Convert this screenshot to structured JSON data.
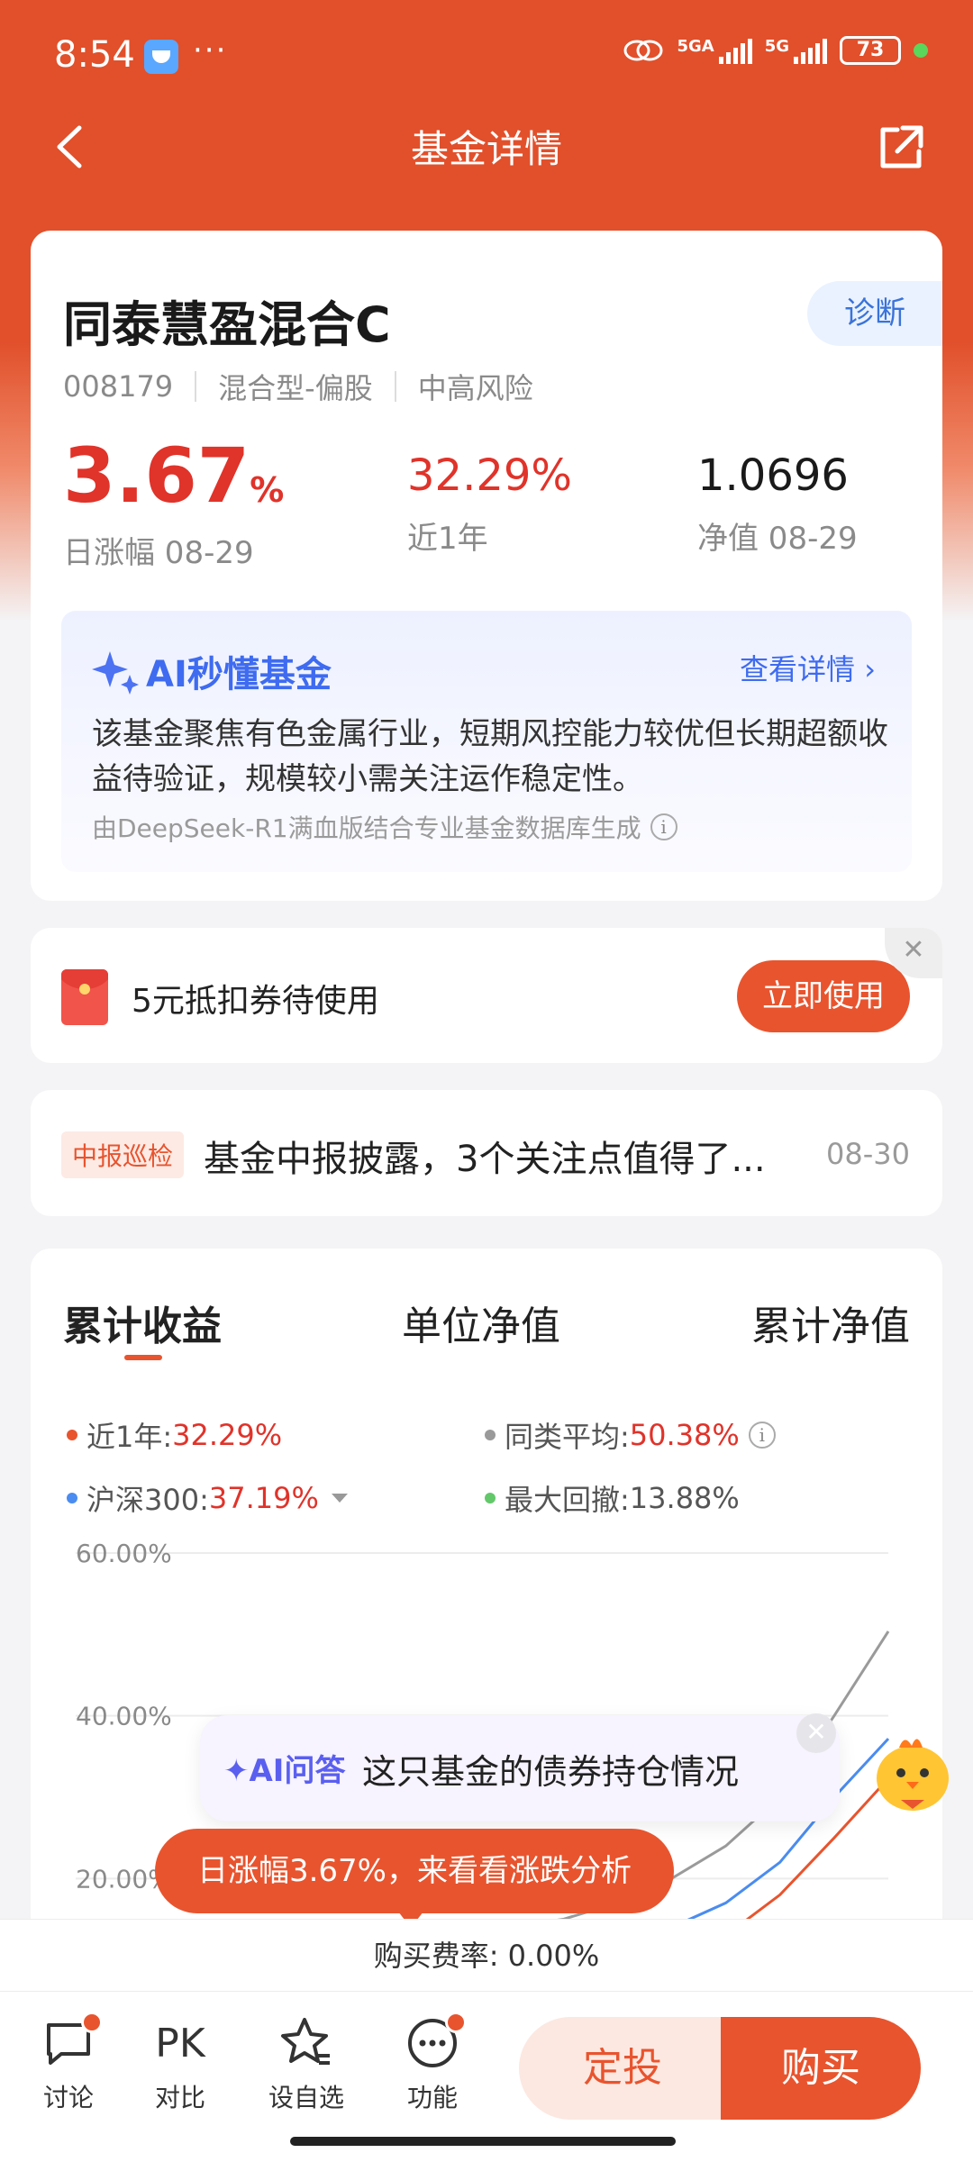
{
  "status_bar": {
    "time": "8:54",
    "dots": "···",
    "net1": "5GA",
    "net2": "5G",
    "battery": "73"
  },
  "nav": {
    "title": "基金详情"
  },
  "fund": {
    "name": "同泰慧盈混合C",
    "diagnose": "诊断",
    "code": "008179",
    "type": "混合型-偏股",
    "risk": "中高风险",
    "daily_change_value": "3.67",
    "daily_change_unit": "%",
    "daily_change_label": "日涨幅 08-29",
    "one_year_value": "32.29%",
    "one_year_label": "近1年",
    "nav_value": "1.0696",
    "nav_label": "净值 08-29"
  },
  "ai_box": {
    "title": "AI秒懂基金",
    "detail_link": "查看详情 ›",
    "summary": "该基金聚焦有色金属行业，短期风控能力较优但长期超额收益待验证，规模较小需关注运作稳定性。",
    "source": "由DeepSeek-R1满血版结合专业基金数据库生成"
  },
  "coupon": {
    "text": "5元抵扣券待使用",
    "button": "立即使用",
    "close": "✕"
  },
  "report": {
    "tag": "中报巡检",
    "title": "基金中报披露，3个关注点值得了...",
    "date": "08-30"
  },
  "chart_tabs": [
    "累计收益",
    "单位净值",
    "累计净值"
  ],
  "stats": {
    "one_year_label": "近1年:",
    "one_year_value": "32.29%",
    "peer_label": "同类平均:",
    "peer_value": "50.38%",
    "hs300_label": "沪深300:",
    "hs300_value": "37.19%",
    "drawdown_label": "最大回撤:",
    "drawdown_value": "13.88%"
  },
  "chart_data": {
    "type": "line",
    "y_ticks": [
      "60.00%",
      "40.00%",
      "20.00%"
    ],
    "ylim": [
      0,
      60
    ],
    "series": [
      {
        "name": "近1年",
        "color": "#e8542e",
        "values": [
          3,
          2,
          4,
          3,
          6,
          5,
          8,
          7,
          10,
          9,
          12,
          14,
          13,
          18,
          25,
          32.29
        ]
      },
      {
        "name": "同类平均",
        "color": "#9a9a9a",
        "values": [
          3,
          4,
          5,
          5,
          7,
          8,
          10,
          12,
          14,
          15,
          17,
          20,
          24,
          30,
          40,
          50.38
        ]
      },
      {
        "name": "沪深300",
        "color": "#4a8cf0",
        "values": [
          2,
          3,
          4,
          4,
          5,
          6,
          7,
          8,
          9,
          11,
          12,
          14,
          17,
          22,
          30,
          37.19
        ]
      }
    ]
  },
  "ai_float": {
    "tag": "✦AI问答",
    "text": "这只基金的债券持仓情况",
    "close": "✕"
  },
  "analysis_bubble": "日涨幅3.67%，来看看涨跌分析",
  "fee": "购买费率: 0.00%",
  "bottom_nav": {
    "discuss": "讨论",
    "pk": "PK",
    "compare": "对比",
    "watch": "设自选",
    "func": "功能",
    "sip": "定投",
    "buy": "购买"
  },
  "colors": {
    "brand": "#e8542e",
    "rise": "#e0332a",
    "ai_blue": "#3e6bf0"
  }
}
